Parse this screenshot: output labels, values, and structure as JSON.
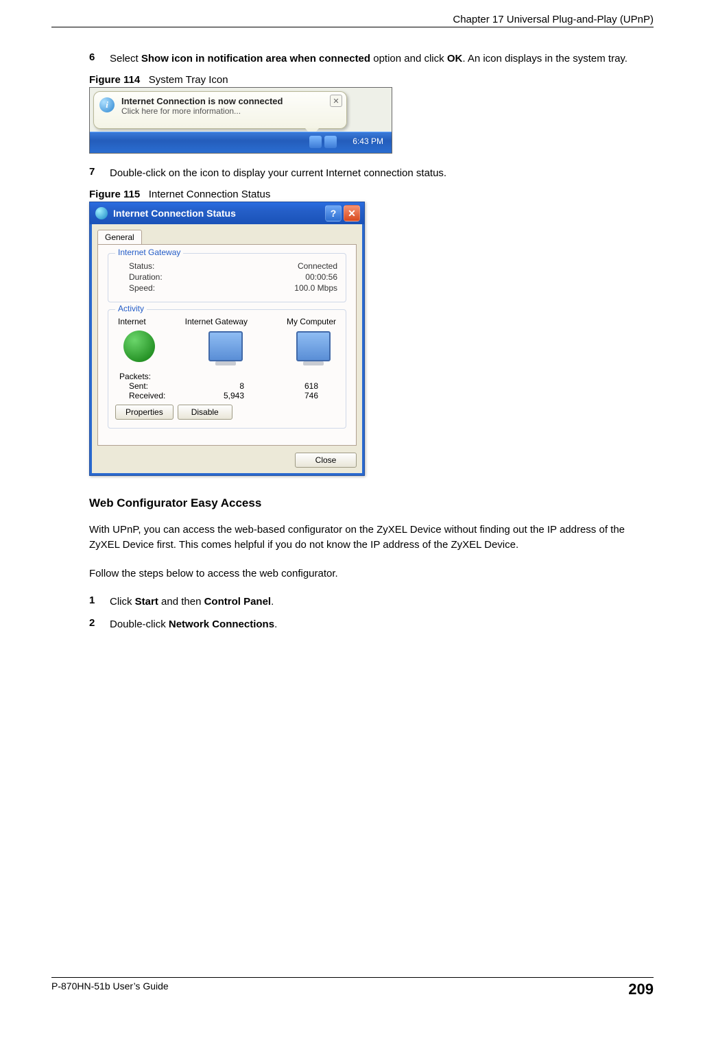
{
  "header": {
    "chapter_title": "Chapter 17 Universal Plug-and-Play (UPnP)"
  },
  "steps_a": [
    {
      "n": "6",
      "pre": "Select ",
      "bold1": "Show icon in notification area when connected",
      "mid1": " option and click ",
      "bold2": "OK",
      "post": ". An icon displays in the system tray."
    }
  ],
  "fig114": {
    "label": "Figure 114",
    "caption": "System Tray Icon",
    "balloon_title": "Internet Connection is now connected",
    "balloon_line2": "Click here for more information...",
    "time": "6:43 PM"
  },
  "steps_b": [
    {
      "n": "7",
      "text": "Double-click on the icon to display your current Internet connection status."
    }
  ],
  "fig115": {
    "label": "Figure 115",
    "caption": "Internet Connection Status",
    "dialog": {
      "title": "Internet Connection Status",
      "tab": "General",
      "group_gateway": {
        "legend": "Internet Gateway",
        "status_l": "Status:",
        "status_v": "Connected",
        "duration_l": "Duration:",
        "duration_v": "00:00:56",
        "speed_l": "Speed:",
        "speed_v": "100.0 Mbps"
      },
      "group_activity": {
        "legend": "Activity",
        "col1": "Internet",
        "col2": "Internet Gateway",
        "col3": "My Computer",
        "packets_l": "Packets:",
        "sent_l": "Sent:",
        "recv_l": "Received:",
        "sent_gw": "8",
        "sent_pc": "618",
        "recv_gw": "5,943",
        "recv_pc": "746",
        "btn_props": "Properties",
        "btn_disable": "Disable"
      },
      "btn_close": "Close"
    }
  },
  "section": {
    "heading": "Web Configurator Easy Access",
    "p1": "With UPnP, you can access the web-based configurator on the ZyXEL Device without finding out the IP address of the ZyXEL Device first. This comes helpful if you do not know the IP address of the ZyXEL Device.",
    "p2": "Follow the steps below to access the web configurator."
  },
  "steps_c": [
    {
      "n": "1",
      "pre": "Click ",
      "b1": "Start",
      "mid": " and then ",
      "b2": "Control Panel",
      "post": "."
    },
    {
      "n": "2",
      "pre": "Double-click ",
      "b1": "Network Connections",
      "post": "."
    }
  ],
  "footer": {
    "guide": "P-870HN-51b User’s Guide",
    "page": "209"
  }
}
